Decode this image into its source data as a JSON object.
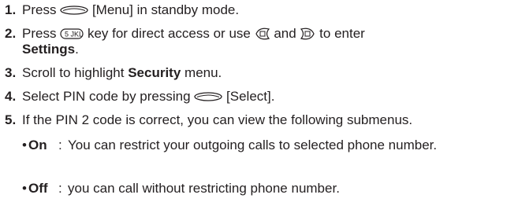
{
  "steps": [
    {
      "number": "1.",
      "before": "Press",
      "icon": "soft-key-icon",
      "after": "[Menu] in standby mode."
    },
    {
      "number": "2.",
      "before": "Press",
      "icon_1": "5-jkl-key-icon",
      "middle": "key for direct access or use",
      "icon_2": "left-nav-key-icon",
      "and": "and",
      "icon_3": "right-nav-key-icon",
      "after": "to enter",
      "strong": "Settings",
      "end": "."
    },
    {
      "number": "3.",
      "before": "Scroll to highlight",
      "strong": "Security",
      "after": "menu."
    },
    {
      "number": "4.",
      "before": "Select PIN code by pressing",
      "icon": "soft-key-icon",
      "after": "[Select]."
    },
    {
      "number": "5.",
      "text": "If the PIN 2 code is correct, you can view the following submenus."
    }
  ],
  "submenus": [
    {
      "bullet": "•",
      "term": "On",
      "colon": ":",
      "description": "You can restrict your outgoing calls to selected phone number."
    },
    {
      "bullet": "•",
      "term": "Off",
      "colon": ":",
      "description": "you can call without restricting phone number."
    }
  ],
  "key_glyph": {
    "5-jkl": "5 JKL"
  }
}
